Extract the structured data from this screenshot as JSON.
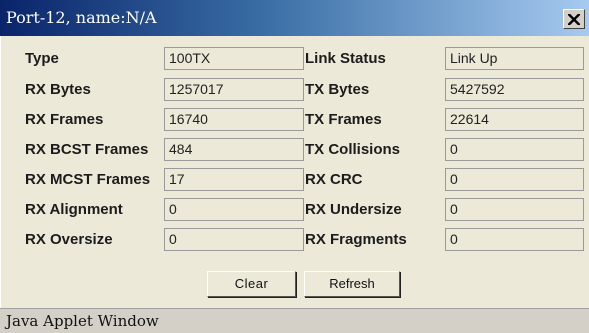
{
  "window": {
    "title": "Port-12, name:N/A",
    "close_icon": "close-x-icon",
    "titlebar_colors": [
      "#0a246a",
      "#3a6ea5",
      "#a6caf0"
    ],
    "background": "#ece9d8"
  },
  "stats": {
    "left": [
      {
        "label": "Type",
        "value": "100TX"
      },
      {
        "label": "RX Bytes",
        "value": "1257017"
      },
      {
        "label": "RX Frames",
        "value": "16740"
      },
      {
        "label": "RX BCST Frames",
        "value": "484"
      },
      {
        "label": "RX MCST Frames",
        "value": "17"
      },
      {
        "label": "RX Alignment",
        "value": "0"
      },
      {
        "label": "RX Oversize",
        "value": "0"
      }
    ],
    "right": [
      {
        "label": "Link Status",
        "value": "Link Up"
      },
      {
        "label": "TX Bytes",
        "value": "5427592"
      },
      {
        "label": "TX Frames",
        "value": "22614"
      },
      {
        "label": "TX Collisions",
        "value": "0"
      },
      {
        "label": "RX CRC",
        "value": "0"
      },
      {
        "label": "RX Undersize",
        "value": "0"
      },
      {
        "label": "RX Fragments",
        "value": "0"
      }
    ]
  },
  "buttons": {
    "clear_label": "Clear",
    "refresh_label": "Refresh"
  },
  "statusbar": {
    "text": "Java Applet Window"
  }
}
